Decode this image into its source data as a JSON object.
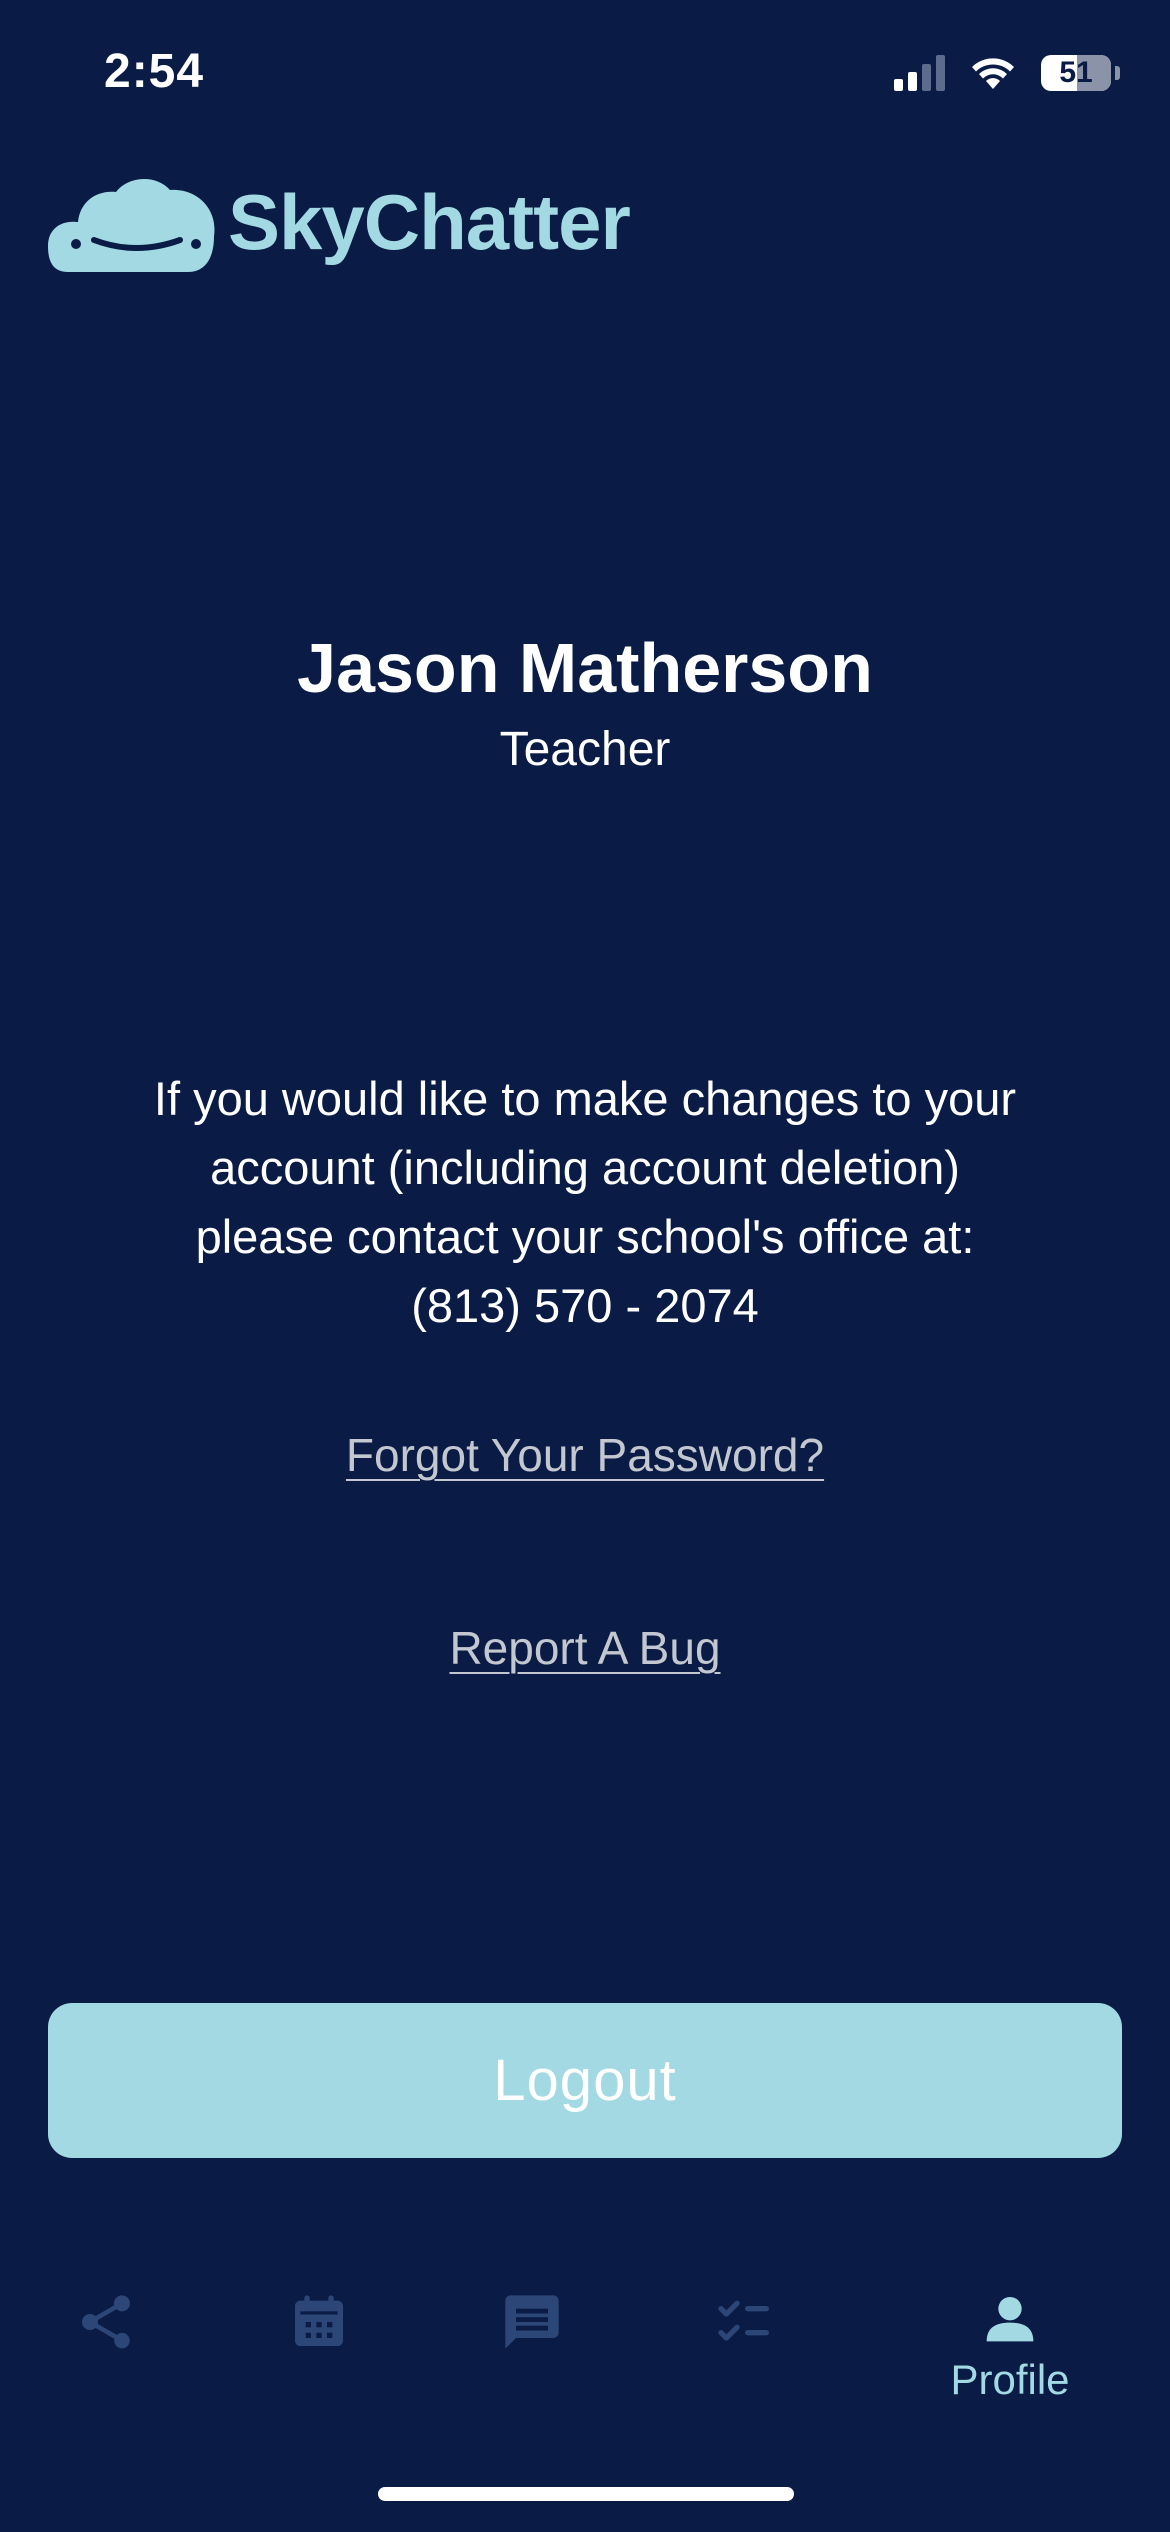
{
  "status_bar": {
    "time": "2:54",
    "battery": "51",
    "signal_icon": "cellular-signal-icon",
    "wifi_icon": "wifi-icon"
  },
  "header": {
    "app_name": "SkyChatter",
    "logo_icon": "cloud-smile-icon"
  },
  "profile": {
    "name": "Jason Matherson",
    "role": "Teacher"
  },
  "info": {
    "lines": [
      "If you would like to make changes to your",
      "account (including account deletion)",
      "please contact your school's office at:",
      "(813) 570 - 2074"
    ]
  },
  "links": {
    "forgot_password": "Forgot Your Password?",
    "report_bug": "Report A Bug"
  },
  "logout_label": "Logout",
  "tab_bar": {
    "items": [
      {
        "icon": "share-icon",
        "label": ""
      },
      {
        "icon": "calendar-icon",
        "label": ""
      },
      {
        "icon": "chat-icon",
        "label": ""
      },
      {
        "icon": "checklist-icon",
        "label": ""
      },
      {
        "icon": "person-icon",
        "label": "Profile",
        "active": true
      }
    ]
  },
  "colors": {
    "background": "#0a1c46",
    "accent": "#a2d9e3",
    "inactive_tab": "#2c4677",
    "link": "#c3c7cf"
  }
}
